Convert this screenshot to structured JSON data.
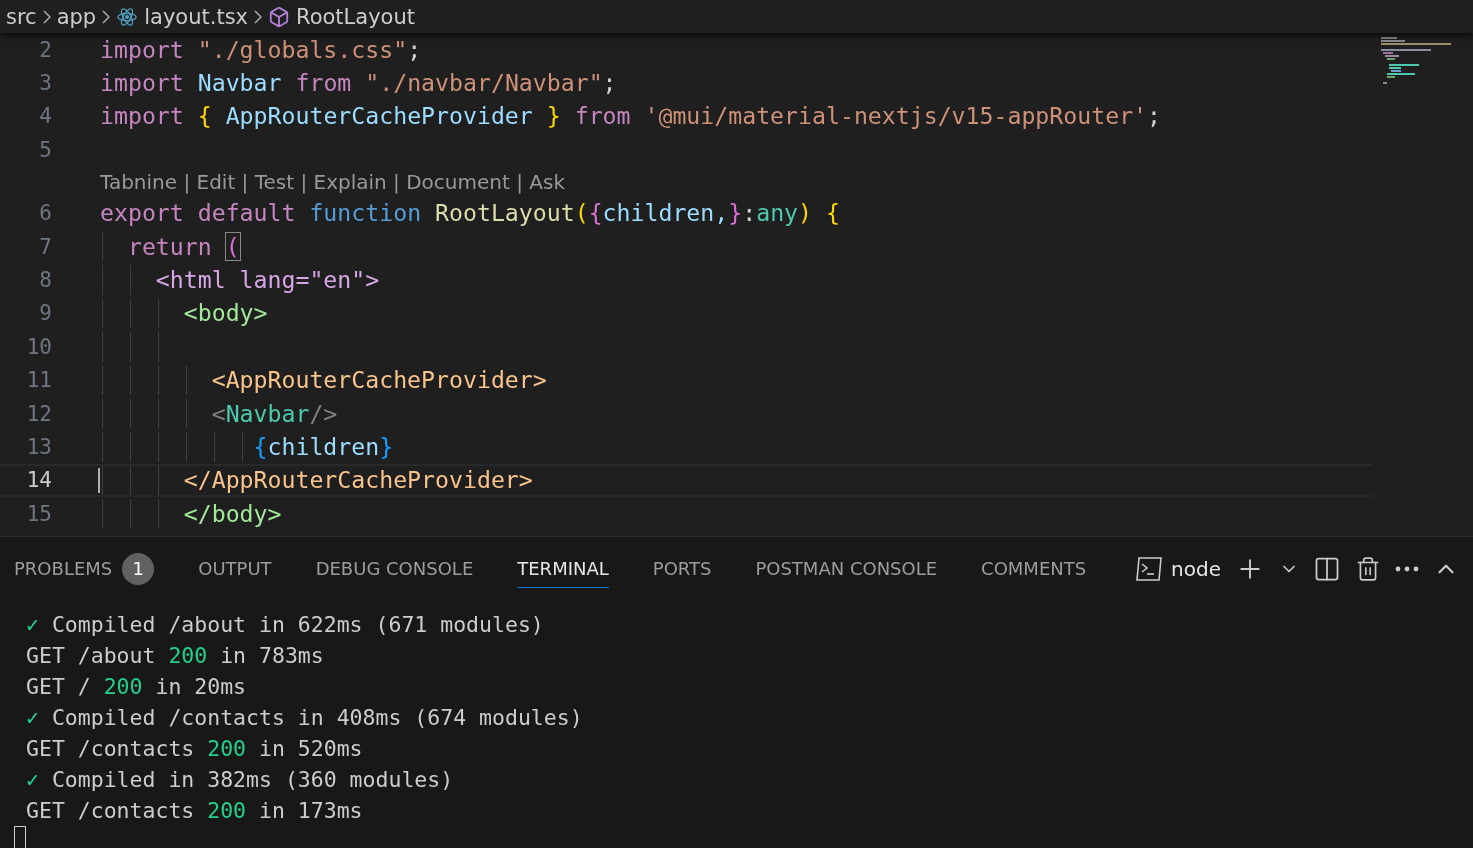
{
  "breadcrumb": [
    {
      "label": "src",
      "kind": "folder"
    },
    {
      "label": "app",
      "kind": "folder"
    },
    {
      "label": "layout.tsx",
      "kind": "file"
    },
    {
      "label": "RootLayout",
      "kind": "symbol"
    }
  ],
  "editor": {
    "lines": [
      {
        "kind": "code",
        "number": "2",
        "current": false,
        "tokens": [
          {
            "text": "import ",
            "kind": "keyword"
          },
          {
            "text": "\"./globals.css\"",
            "kind": "string"
          },
          {
            "text": ";",
            "kind": "plain"
          }
        ]
      },
      {
        "kind": "code",
        "number": "3",
        "current": false,
        "tokens": [
          {
            "text": "import ",
            "kind": "keyword"
          },
          {
            "text": "Navbar ",
            "kind": "variable"
          },
          {
            "text": "from ",
            "kind": "keyword"
          },
          {
            "text": "\"./navbar/Navbar\"",
            "kind": "string"
          },
          {
            "text": ";",
            "kind": "plain"
          }
        ]
      },
      {
        "kind": "code",
        "number": "4",
        "current": false,
        "tokens": [
          {
            "text": "import ",
            "kind": "keyword"
          },
          {
            "text": "{ ",
            "kind": "bracket1"
          },
          {
            "text": "AppRouterCacheProvider ",
            "kind": "variable"
          },
          {
            "text": "} ",
            "kind": "bracket1"
          },
          {
            "text": "from ",
            "kind": "keyword"
          },
          {
            "text": "'@mui/material-nextjs/v15-appRouter'",
            "kind": "string"
          },
          {
            "text": ";",
            "kind": "plain"
          }
        ]
      },
      {
        "kind": "code",
        "number": "5",
        "current": false
      },
      {
        "kind": "codelens",
        "text": "Tabnine | Edit | Test | Explain | Document | Ask"
      },
      {
        "kind": "code",
        "number": "6",
        "current": false,
        "tokens": [
          {
            "text": "export default ",
            "kind": "keyword"
          },
          {
            "text": "function ",
            "kind": "storage"
          },
          {
            "text": "RootLayout",
            "kind": "func"
          },
          {
            "text": "(",
            "kind": "bracket1"
          },
          {
            "text": "{",
            "kind": "bracket2"
          },
          {
            "text": "children,",
            "kind": "variable"
          },
          {
            "text": "}",
            "kind": "bracket2"
          },
          {
            "text": ":",
            "kind": "plain"
          },
          {
            "text": "any",
            "kind": "type"
          },
          {
            "text": ") ",
            "kind": "bracket1"
          },
          {
            "text": "{",
            "kind": "bracket1"
          }
        ]
      },
      {
        "kind": "code",
        "number": "7",
        "current": false,
        "tokens": [
          {
            "text": "  return ",
            "kind": "keyword"
          },
          {
            "text": "(",
            "kind": "matched"
          }
        ]
      },
      {
        "kind": "code",
        "number": "8",
        "current": false,
        "tokens": [
          {
            "text": "    <html lang=\"en\">",
            "kind": "tag1"
          }
        ]
      },
      {
        "kind": "code",
        "number": "9",
        "current": false,
        "tokens": [
          {
            "text": "      <body>",
            "kind": "tag2"
          }
        ]
      },
      {
        "kind": "code",
        "number": "10",
        "current": false
      },
      {
        "kind": "code",
        "number": "11",
        "current": false,
        "tokens": [
          {
            "text": "        <AppRouterCacheProvider>",
            "kind": "tag3"
          }
        ]
      },
      {
        "kind": "code",
        "number": "12",
        "current": false,
        "tokens": [
          {
            "text": "        <",
            "kind": "tagpunct"
          },
          {
            "text": "Navbar",
            "kind": "type"
          },
          {
            "text": "/>",
            "kind": "tagpunct"
          }
        ]
      },
      {
        "kind": "code",
        "number": "13",
        "current": false,
        "tokens": [
          {
            "text": "           {",
            "kind": "bracket3"
          },
          {
            "text": "children",
            "kind": "variable"
          },
          {
            "text": "}",
            "kind": "bracket3"
          }
        ]
      },
      {
        "kind": "code",
        "number": "14",
        "current": true,
        "tokens": [
          {
            "text": "      </AppRouterCacheProvider>",
            "kind": "tag3"
          }
        ]
      },
      {
        "kind": "code",
        "number": "15",
        "current": false,
        "tokens": [
          {
            "text": "      </body>",
            "kind": "tag2"
          }
        ]
      }
    ]
  },
  "panel": {
    "tabs": [
      {
        "label": "PROBLEMS",
        "badge": "1",
        "selected": false
      },
      {
        "label": "OUTPUT",
        "selected": false
      },
      {
        "label": "DEBUG CONSOLE",
        "selected": false
      },
      {
        "label": "TERMINAL",
        "selected": true
      },
      {
        "label": "PORTS",
        "selected": false
      },
      {
        "label": "POSTMAN CONSOLE",
        "selected": false
      },
      {
        "label": "COMMENTS",
        "selected": false
      }
    ],
    "terminal_name": "node",
    "terminal_lines": [
      [
        {
          "text": "✓",
          "kind": "check"
        },
        {
          "text": " Compiled /about in 622ms (671 modules)",
          "kind": "plain"
        }
      ],
      [
        {
          "text": "GET /about ",
          "kind": "plain"
        },
        {
          "text": "200",
          "kind": "status"
        },
        {
          "text": " in 783ms",
          "kind": "plain"
        }
      ],
      [
        {
          "text": "GET / ",
          "kind": "plain"
        },
        {
          "text": "200",
          "kind": "status"
        },
        {
          "text": " in 20ms",
          "kind": "plain"
        }
      ],
      [
        {
          "text": "✓",
          "kind": "check"
        },
        {
          "text": " Compiled /contacts in 408ms (674 modules)",
          "kind": "plain"
        }
      ],
      [
        {
          "text": "GET /contacts ",
          "kind": "plain"
        },
        {
          "text": "200",
          "kind": "status"
        },
        {
          "text": " in 520ms",
          "kind": "plain"
        }
      ],
      [
        {
          "text": "✓",
          "kind": "check"
        },
        {
          "text": " Compiled in 382ms (360 modules)",
          "kind": "plain"
        }
      ],
      [
        {
          "text": "GET /contacts ",
          "kind": "plain"
        },
        {
          "text": "200",
          "kind": "status"
        },
        {
          "text": " in 173ms",
          "kind": "plain"
        }
      ]
    ]
  }
}
